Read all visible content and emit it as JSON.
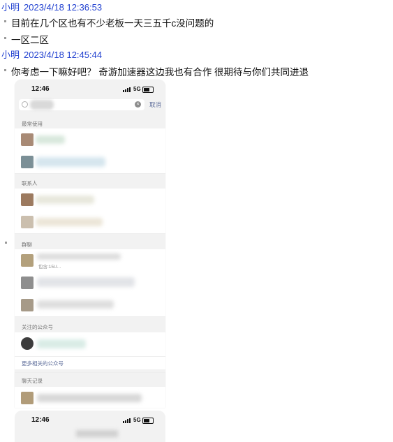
{
  "messages": [
    {
      "sender": "小明",
      "time": "2023/4/18 12:36:53",
      "lines": [
        "目前在几个区也有不少老板一天三五千c没问题的",
        "一区二区"
      ]
    },
    {
      "sender": "小明",
      "time": "2023/4/18 12:45:44",
      "lines": [
        "你考虑一下嘛好吧？ 奇游加速器这边我也有合作 很期待与你们共同进退"
      ]
    }
  ],
  "phone": {
    "status_time": "12:46",
    "network": "5G",
    "search_cancel": "取消",
    "sections": {
      "frequent": "最常使用",
      "contacts": "联系人",
      "groups": "群聊",
      "official": "关注的公众号",
      "more_official": "更多相关的公众号",
      "chat_history": "聊天记录"
    },
    "group_row_snippet": "包含:15U..."
  },
  "phone2": {
    "status_time": "12:46",
    "network": "5G"
  }
}
